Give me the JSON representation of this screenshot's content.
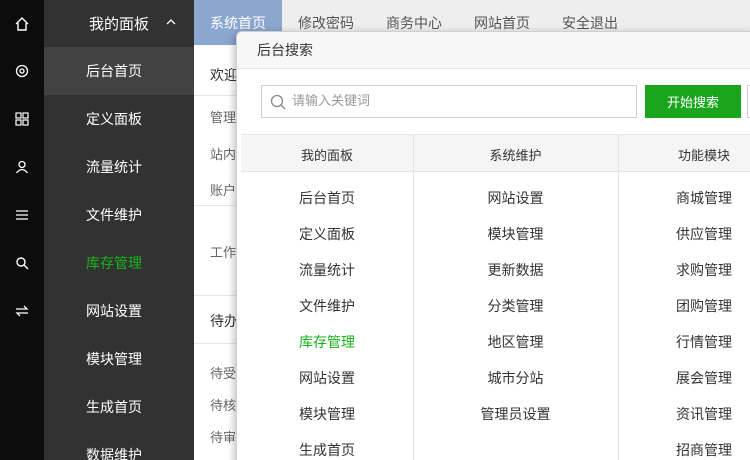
{
  "rail": {
    "icons": [
      "home-icon",
      "settings-icon",
      "grid-icon",
      "user-icon",
      "list-icon",
      "search-icon",
      "swap-icon"
    ]
  },
  "sidebar": {
    "header": "我的面板",
    "items": [
      {
        "label": "后台首页",
        "state": "active"
      },
      {
        "label": "定义面板",
        "state": "normal"
      },
      {
        "label": "流量统计",
        "state": "normal"
      },
      {
        "label": "文件维护",
        "state": "normal"
      },
      {
        "label": "库存管理",
        "state": "highlight"
      },
      {
        "label": "网站设置",
        "state": "normal"
      },
      {
        "label": "模块管理",
        "state": "normal"
      },
      {
        "label": "生成首页",
        "state": "normal"
      },
      {
        "label": "数据维护",
        "state": "normal"
      }
    ]
  },
  "topnav": {
    "tabs": [
      "系统首页",
      "修改密码",
      "商务中心",
      "网站首页",
      "安全退出"
    ],
    "active_index": 0
  },
  "background": {
    "texts": [
      "欢迎",
      "管理",
      "站内",
      "账户",
      "工作",
      "待办",
      "待受",
      "待核",
      "待审"
    ]
  },
  "panel": {
    "title": "后台搜索",
    "search_placeholder": "请输入关键词",
    "search_button": "开始搜索",
    "columns": [
      {
        "header": "我的面板",
        "items": [
          "后台首页",
          "定义面板",
          "流量统计",
          "文件维护",
          "库存管理",
          "网站设置",
          "模块管理",
          "生成首页"
        ]
      },
      {
        "header": "系统维护",
        "items": [
          "网站设置",
          "模块管理",
          "更新数据",
          "分类管理",
          "地区管理",
          "城市分站",
          "管理员设置"
        ]
      },
      {
        "header": "功能模块",
        "items": [
          "商城管理",
          "供应管理",
          "求购管理",
          "团购管理",
          "行情管理",
          "展会管理",
          "资讯管理",
          "招商管理"
        ]
      }
    ],
    "highlight_item": "库存管理"
  },
  "colors": {
    "rail_bg": "#0c0c0c",
    "sidebar_bg": "#323232",
    "active_item_bg": "#424242",
    "highlight_green": "#18b31b",
    "active_tab_bg": "#8ba6cf",
    "search_button_bg": "#19a51c"
  }
}
